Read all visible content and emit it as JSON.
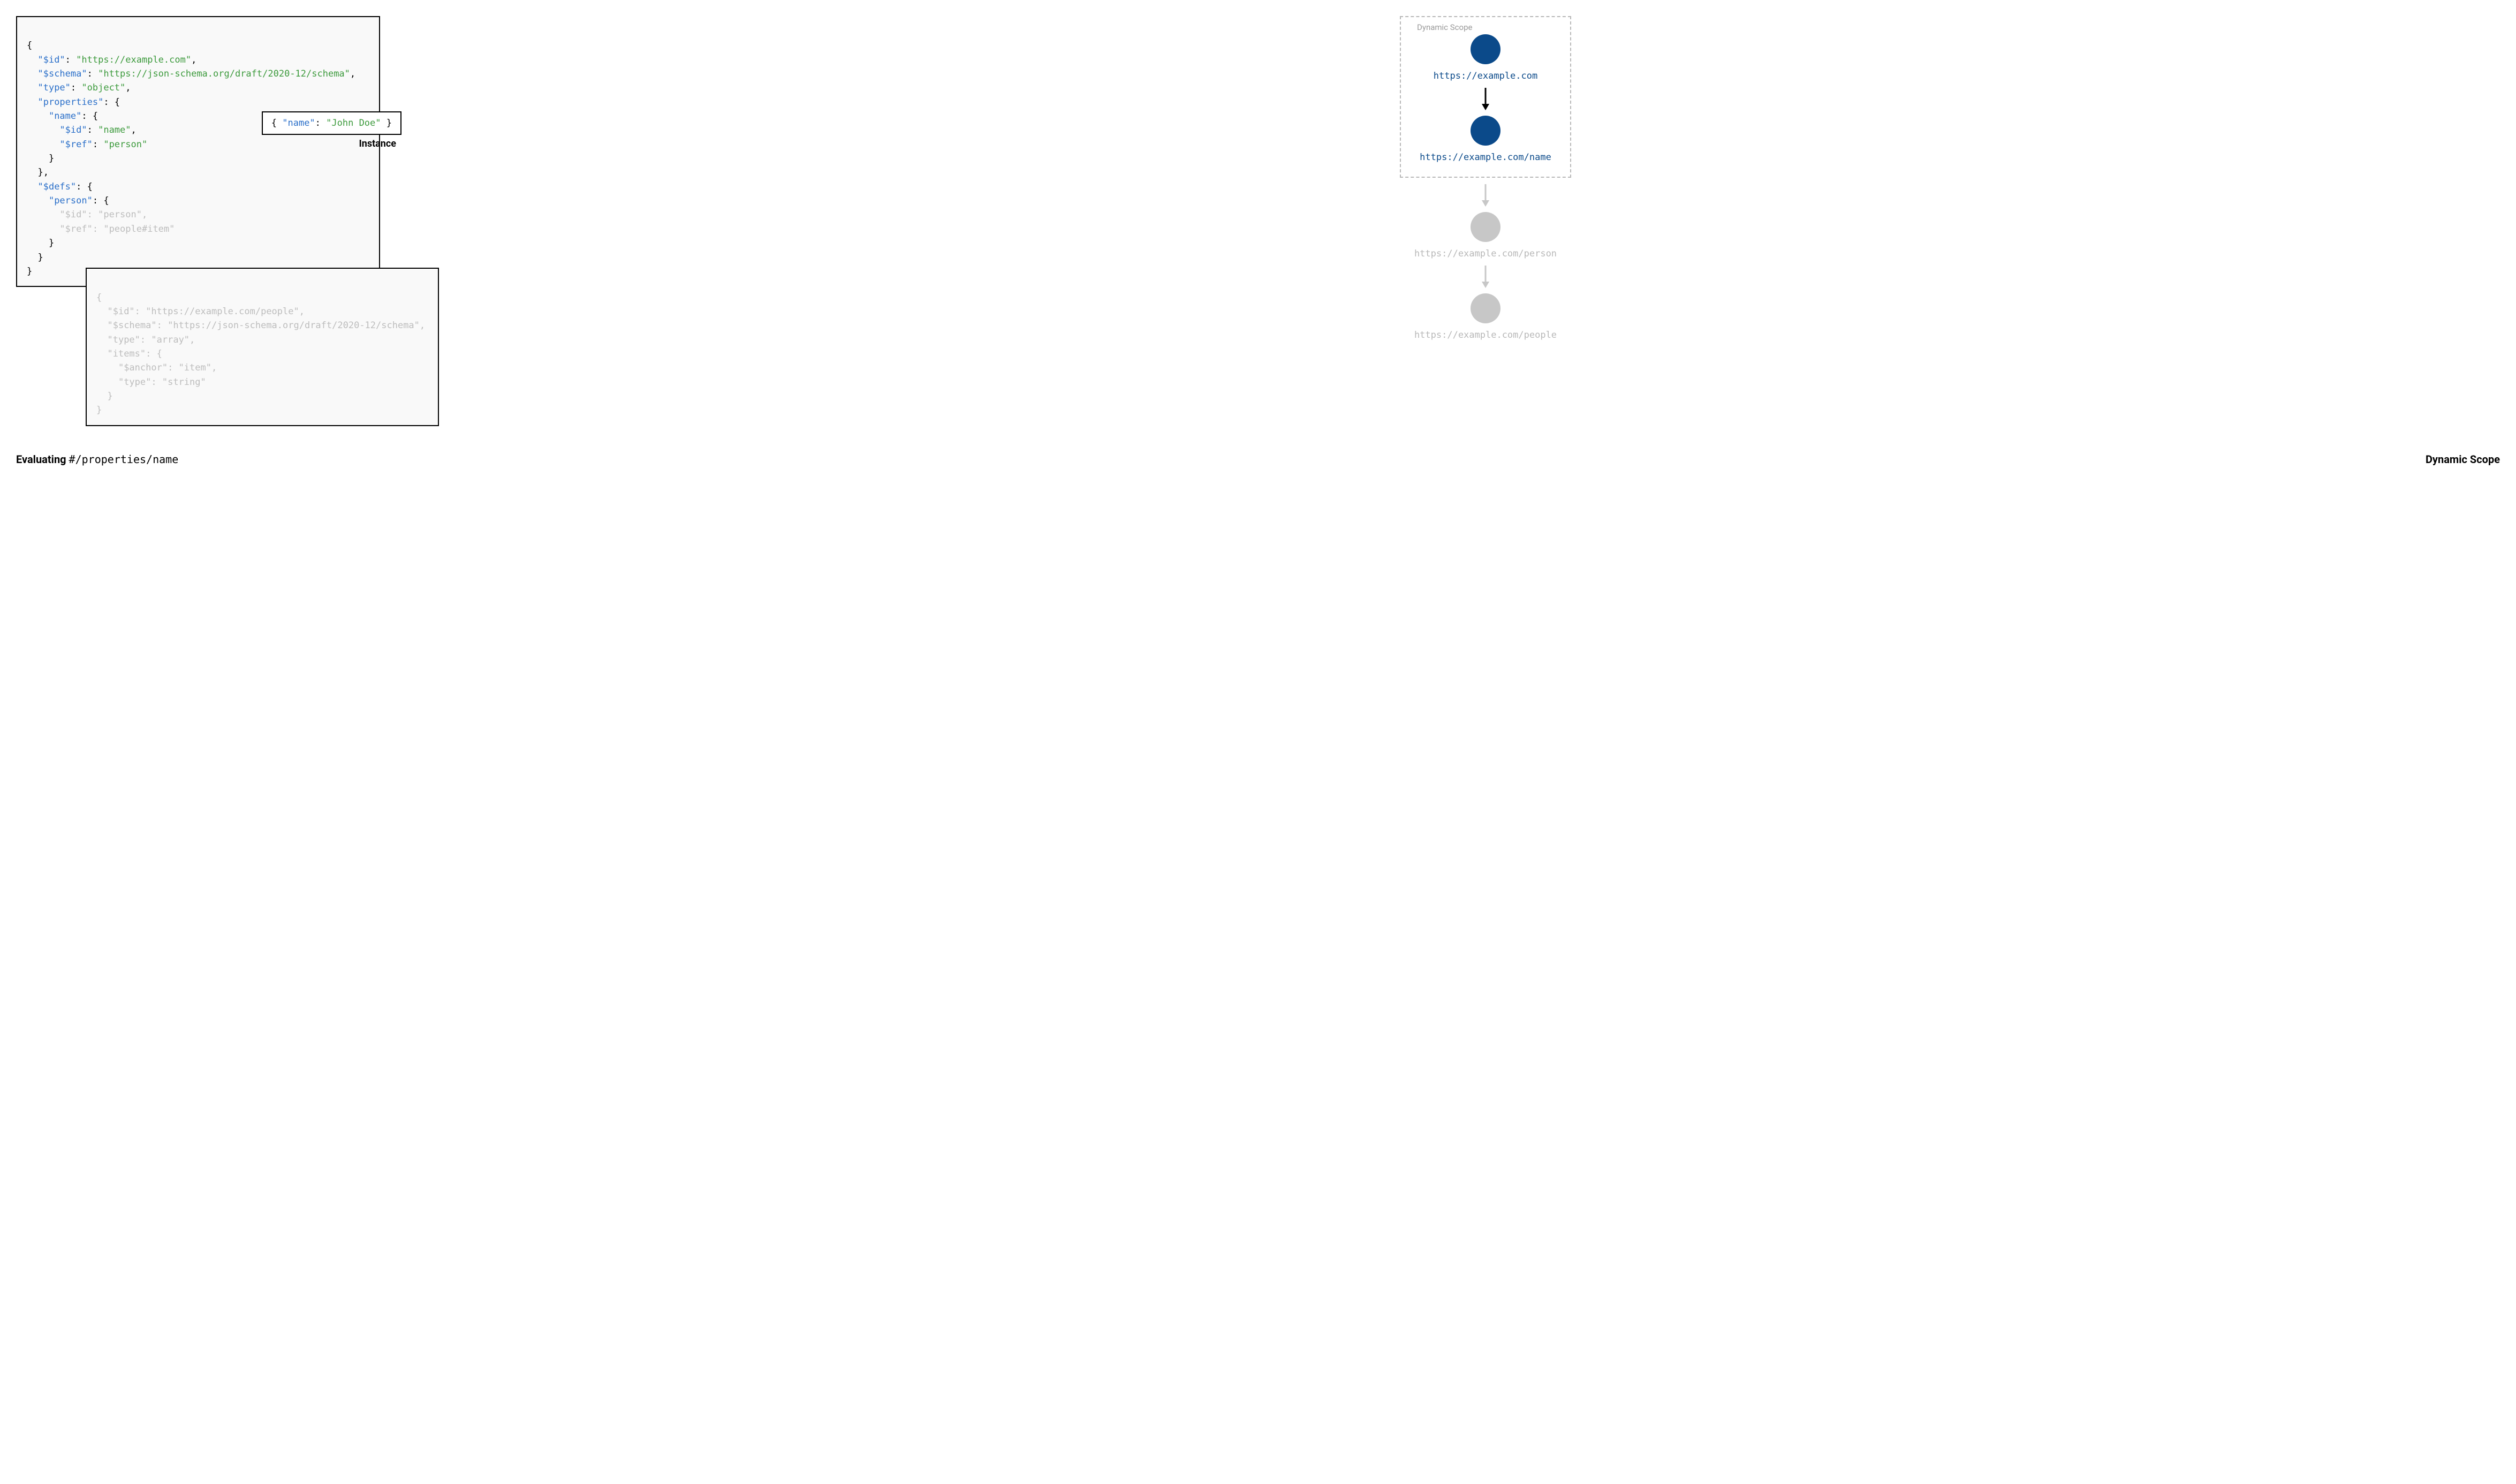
{
  "schema1": {
    "line1": "{",
    "id_key": "\"$id\"",
    "id_val": "\"https://example.com\"",
    "schema_key": "\"$schema\"",
    "schema_val": "\"https://json-schema.org/draft/2020-12/schema\"",
    "type_key": "\"type\"",
    "type_val": "\"object\"",
    "props_key": "\"properties\"",
    "name_key": "\"name\"",
    "name_id_key": "\"$id\"",
    "name_id_val": "\"name\"",
    "name_ref_key": "\"$ref\"",
    "name_ref_val": "\"person\"",
    "defs_key": "\"$defs\"",
    "person_key": "\"person\"",
    "person_id_key": "\"$id\"",
    "person_id_val": "\"person\"",
    "person_ref_key": "\"$ref\"",
    "person_ref_val": "\"people#item\""
  },
  "schema2": {
    "id_key": "\"$id\"",
    "id_val": "\"https://example.com/people\"",
    "schema_key": "\"$schema\"",
    "schema_val": "\"https://json-schema.org/draft/2020-12/schema\"",
    "type_key": "\"type\"",
    "type_val": "\"array\"",
    "items_key": "\"items\"",
    "anchor_key": "\"$anchor\"",
    "anchor_val": "\"item\"",
    "itype_key": "\"type\"",
    "itype_val": "\"string\""
  },
  "instance": {
    "name_key": "\"name\"",
    "name_val": "\"John Doe\"",
    "label": "Instance"
  },
  "caption": {
    "eval_bold": "Evaluating ",
    "eval_path": "#/properties/name",
    "right": "Dynamic Scope"
  },
  "scope": {
    "box_title": "Dynamic Scope",
    "node1_label": "https://example.com",
    "node2_label": "https://example.com/name",
    "node3_label": "https://example.com/person",
    "node4_label": "https://example.com/people"
  }
}
